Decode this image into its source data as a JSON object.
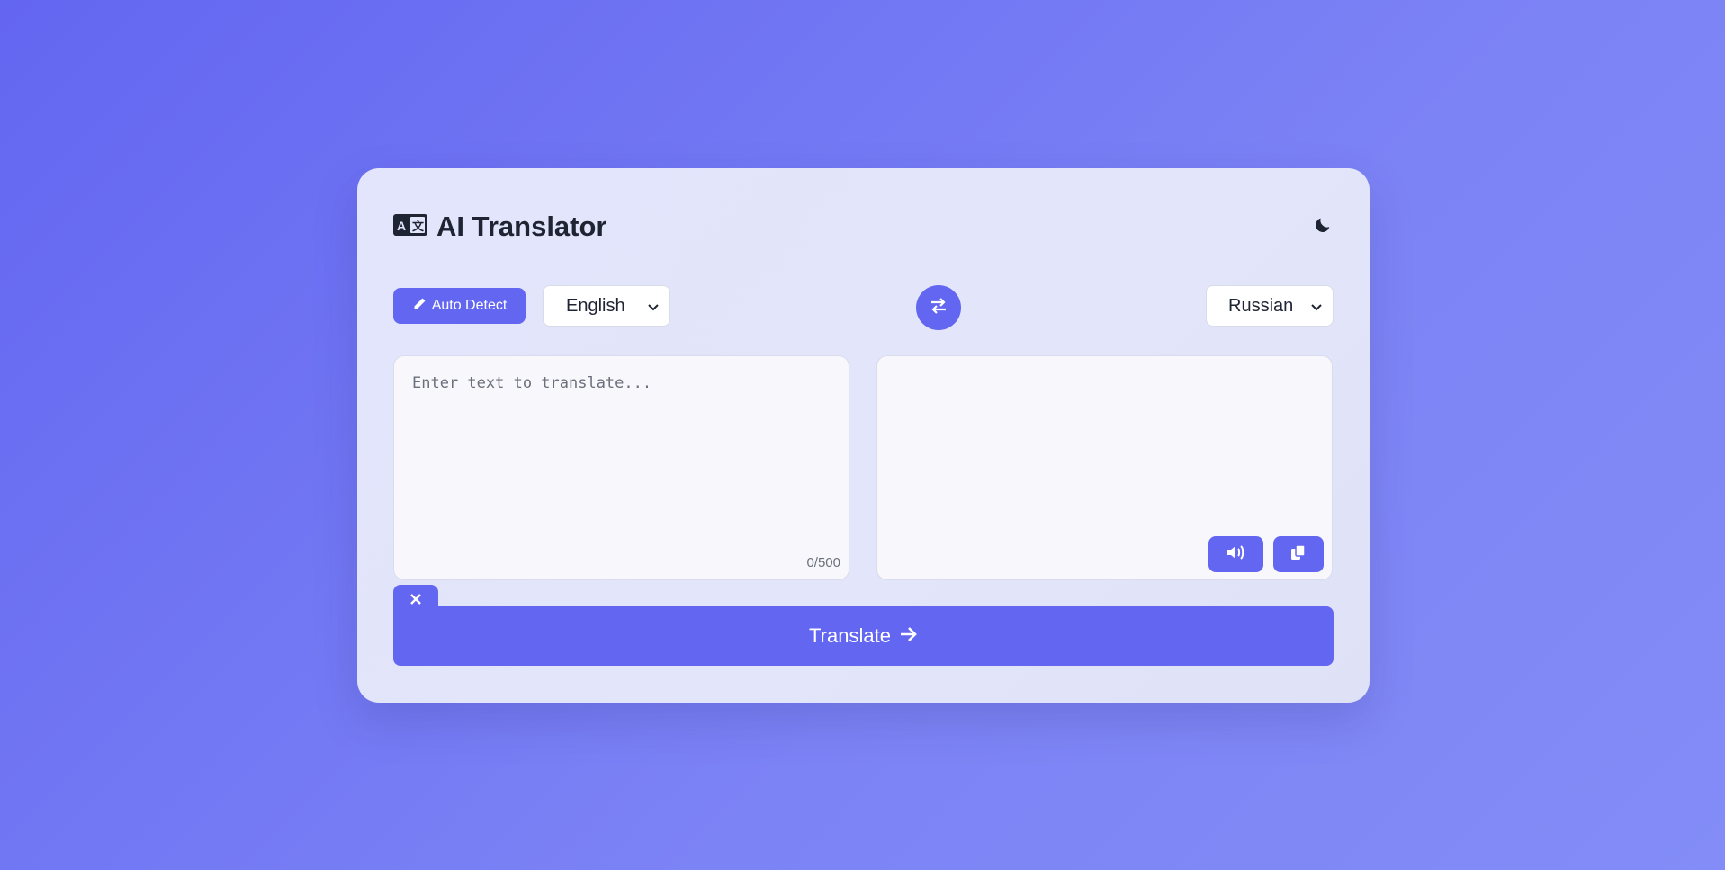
{
  "app": {
    "title": "AI Translator",
    "logo_icon": "translate-icon",
    "theme_toggle_icon": "moon-icon"
  },
  "controls": {
    "auto_detect_label": "Auto Detect",
    "auto_detect_icon": "pencil-icon",
    "source_language": "English",
    "target_language": "Russian",
    "swap_icon": "swap-arrows-icon"
  },
  "input": {
    "placeholder": "Enter text to translate...",
    "value": "",
    "char_count": "0/500"
  },
  "output": {
    "value": "",
    "speak_icon": "speaker-icon",
    "copy_icon": "copy-icon"
  },
  "actions": {
    "clear_icon": "close-icon",
    "translate_label": "Translate",
    "translate_icon": "arrow-right-icon"
  },
  "colors": {
    "accent": "#6366f1",
    "background": "#6d74f3",
    "card": "#e2e5fb",
    "text": "#1f2433"
  }
}
